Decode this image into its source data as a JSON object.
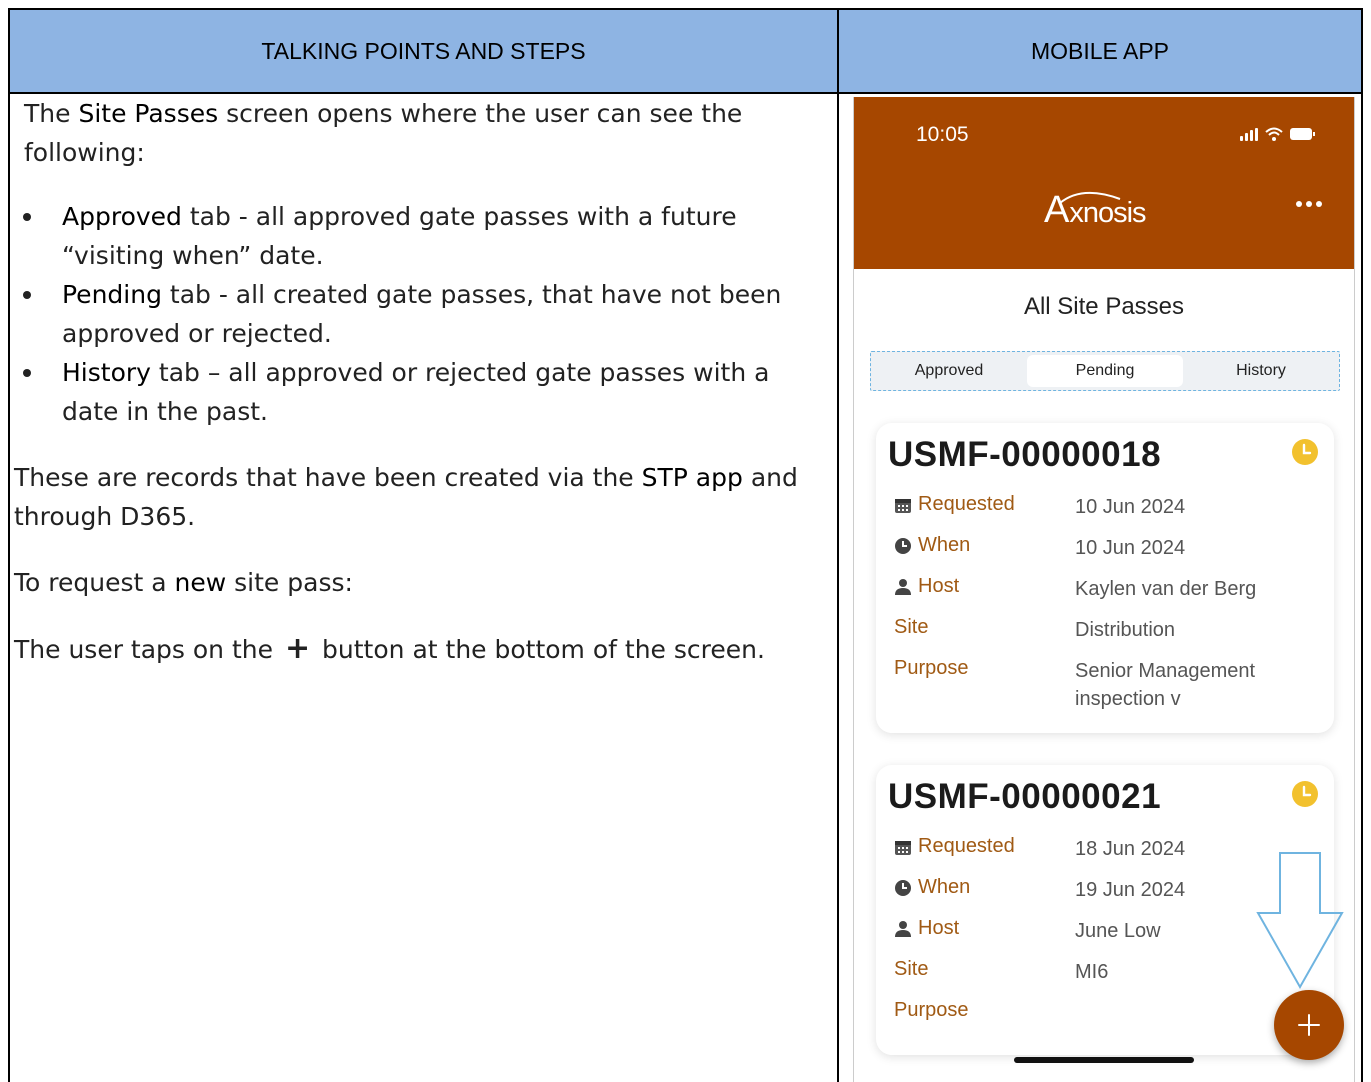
{
  "table": {
    "header_left": "TALKING POINTS AND STEPS",
    "header_right": "MOBILE APP"
  },
  "left": {
    "intro_pre": "The ",
    "intro_kw": "Site Passes",
    "intro_post": " screen opens where the user can see the following:",
    "bullets": [
      {
        "kw": "Approved",
        "text": " tab - all approved gate passes with a future “visiting when” date."
      },
      {
        "kw": "Pending",
        "text": " tab - all created gate passes, that have not been approved or rejected."
      },
      {
        "kw": "History",
        "text": " tab – all approved or rejected gate passes with a date in the past."
      }
    ],
    "records_pre": "These are records that have been created via the ",
    "records_kw": "STP app",
    "records_post": " and through D365.",
    "request_pre": "To request a ",
    "request_kw": "new",
    "request_post": " site pass:",
    "tap_pre": "The user taps on the ",
    "tap_glyph": "+",
    "tap_post": " button at the bottom of the screen."
  },
  "phone": {
    "time": "10:05",
    "logo_first": "A",
    "logo_rest": "xnosis",
    "title": "All Site Passes",
    "tabs": [
      "Approved",
      "Pending",
      "History"
    ],
    "active_tab": "Pending",
    "labels": {
      "requested": "Requested",
      "when": "When",
      "host": "Host",
      "site": "Site",
      "purpose": "Purpose"
    },
    "cards": [
      {
        "id": "USMF-00000018",
        "requested": "10 Jun 2024",
        "when": "10 Jun 2024",
        "host": "Kaylen van der Berg",
        "site": "Distribution",
        "purpose_line1": "Senior Management",
        "purpose_line2": "inspection v"
      },
      {
        "id": "USMF-00000021",
        "requested": "18 Jun 2024",
        "when": "19 Jun 2024",
        "host": "June Low",
        "site": "MI6",
        "purpose_line1": "",
        "purpose_line2": ""
      }
    ],
    "colors": {
      "header": "#a64700",
      "label": "#a05a14",
      "status_pending": "#f2c12e",
      "fab": "#a64700"
    },
    "icons": {
      "requested": "calendar-icon",
      "when": "clock-icon",
      "host": "person-icon",
      "status": "pending-clock-icon",
      "fab": "plus-icon"
    }
  }
}
